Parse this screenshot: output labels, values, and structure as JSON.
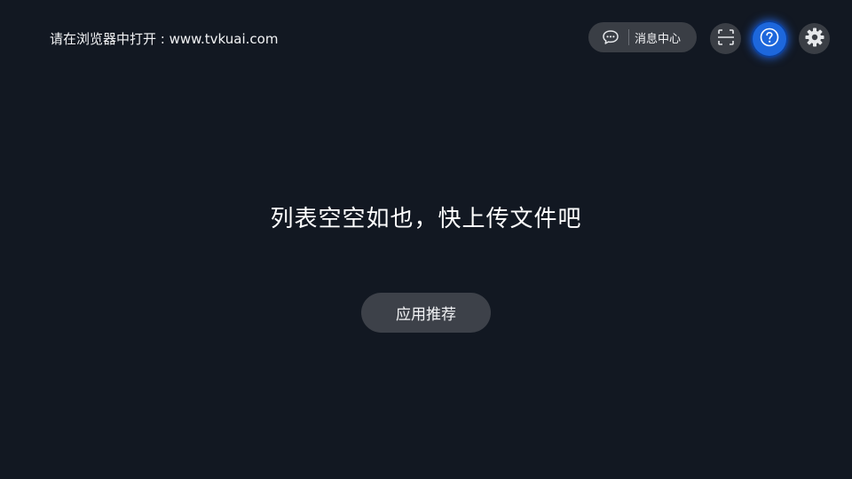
{
  "header": {
    "open_hint": "请在浏览器中打开 : www.tvkuai.com",
    "message_center_label": "消息中心",
    "icons": {
      "message": "chat-bubble-icon",
      "scan": "scan-icon",
      "help": "help-question-icon",
      "settings": "gear-icon"
    }
  },
  "main": {
    "empty_message": "列表空空如也，快上传文件吧",
    "recommend_button_label": "应用推荐"
  },
  "colors": {
    "background": "#121822",
    "button_bg": "#3a3e45",
    "focus_accent": "#1d67dc"
  }
}
